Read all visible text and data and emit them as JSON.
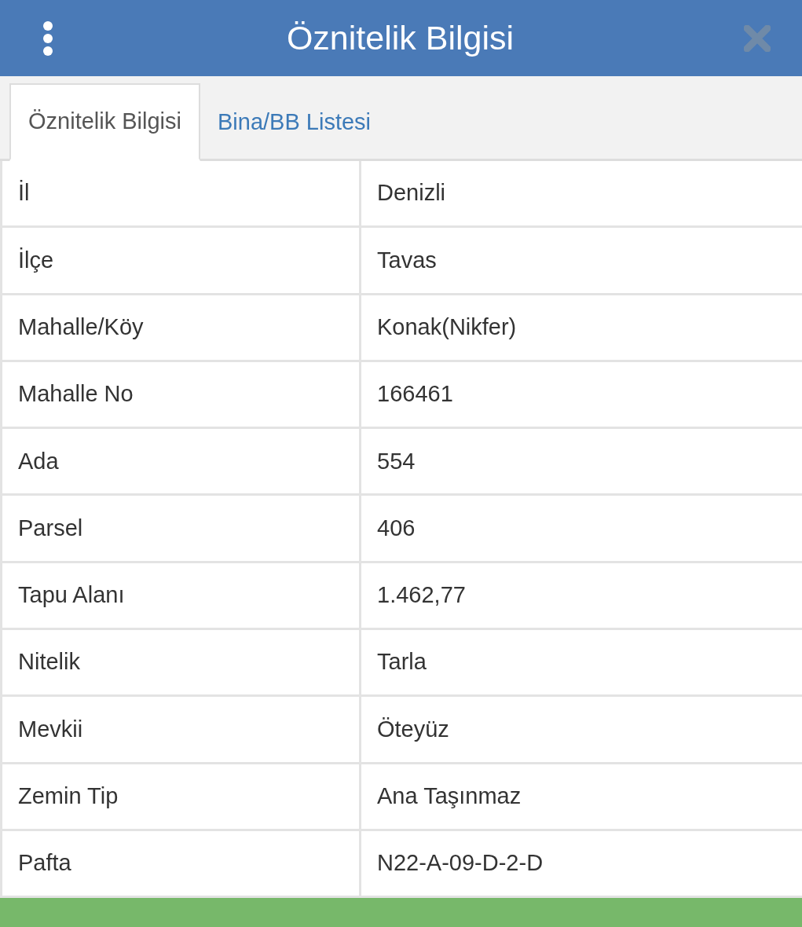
{
  "window": {
    "title": "Öznitelik Bilgisi"
  },
  "tabs": [
    {
      "label": "Öznitelik Bilgisi",
      "selected": true
    },
    {
      "label": "Bina/BB Listesi",
      "selected": false
    }
  ],
  "table": {
    "rows": [
      {
        "label": "İl",
        "value": "Denizli"
      },
      {
        "label": "İlçe",
        "value": "Tavas"
      },
      {
        "label": "Mahalle/Köy",
        "value": "Konak(Nikfer)"
      },
      {
        "label": "Mahalle No",
        "value": "166461"
      },
      {
        "label": "Ada",
        "value": "554"
      },
      {
        "label": "Parsel",
        "value": "406"
      },
      {
        "label": "Tapu Alanı",
        "value": "1.462,77"
      },
      {
        "label": "Nitelik",
        "value": "Tarla"
      },
      {
        "label": "Mevkii",
        "value": "Öteyüz"
      },
      {
        "label": "Zemin Tip",
        "value": "Ana Taşınmaz"
      },
      {
        "label": "Pafta",
        "value": "N22-A-09-D-2-D"
      }
    ]
  }
}
